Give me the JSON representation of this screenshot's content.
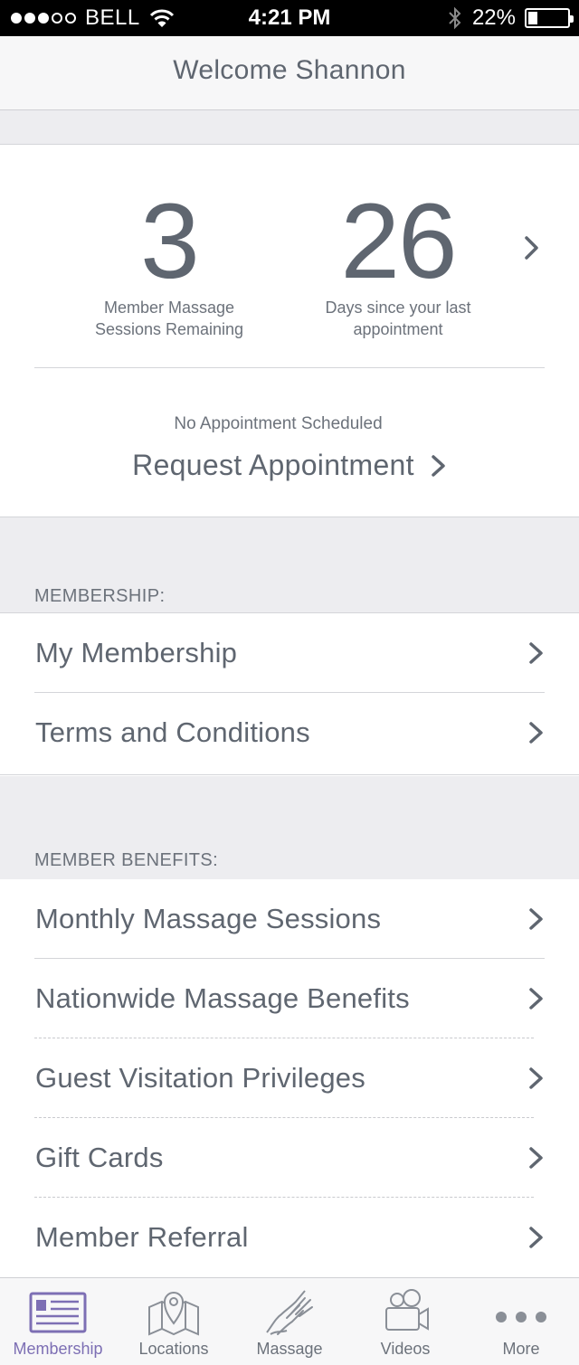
{
  "status_bar": {
    "carrier": "BELL",
    "time": "4:21 PM",
    "battery": "22%",
    "battery_level": 0.22,
    "signal_full": 3,
    "signal_total": 5
  },
  "header": {
    "title": "Welcome Shannon"
  },
  "stats": {
    "sessions_value": "3",
    "sessions_label": "Member Massage Sessions Remaining",
    "days_value": "26",
    "days_label": "Days since your last appointment"
  },
  "appointment": {
    "status": "No Appointment Scheduled",
    "request_label": "Request Appointment"
  },
  "membership": {
    "header": "MEMBERSHIP:",
    "items": [
      {
        "label": "My Membership"
      },
      {
        "label": "Terms and Conditions"
      }
    ]
  },
  "benefits": {
    "header": "MEMBER BENEFITS:",
    "items": [
      {
        "label": "Monthly Massage Sessions"
      },
      {
        "label": "Nationwide Massage Benefits"
      },
      {
        "label": "Guest Visitation Privileges"
      },
      {
        "label": "Gift Cards"
      },
      {
        "label": "Member Referral"
      }
    ]
  },
  "tabs": [
    {
      "label": "Membership",
      "icon": "membership-card-icon",
      "active": true
    },
    {
      "label": "Locations",
      "icon": "map-pin-icon",
      "active": false
    },
    {
      "label": "Massage",
      "icon": "hand-icon",
      "active": false
    },
    {
      "label": "Videos",
      "icon": "video-camera-icon",
      "active": false
    },
    {
      "label": "More",
      "icon": "more-dots-icon",
      "active": false
    }
  ],
  "colors": {
    "text": "#5f6670",
    "accent": "#7d6fb4",
    "band": "#ededf0"
  }
}
